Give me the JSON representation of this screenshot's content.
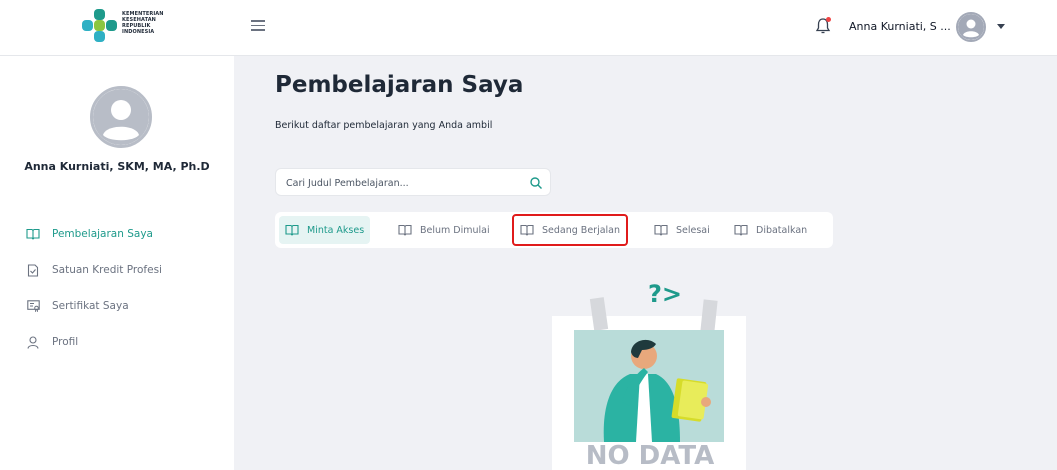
{
  "header": {
    "logo_lines": [
      "KEMENTERIAN",
      "KESEHATAN",
      "REPUBLIK",
      "INDONESIA"
    ],
    "user_name": "Anna Kurniati, S ..."
  },
  "sidebar": {
    "profile_name": "Anna Kurniati, SKM, MA, Ph.D",
    "items": [
      {
        "label": "Pembelajaran Saya",
        "icon": "book-open-icon",
        "active": true
      },
      {
        "label": "Satuan Kredit Profesi",
        "icon": "document-check-icon",
        "active": false
      },
      {
        "label": "Sertifikat Saya",
        "icon": "certificate-icon",
        "active": false
      },
      {
        "label": "Profil",
        "icon": "user-icon",
        "active": false
      }
    ]
  },
  "main": {
    "title": "Pembelajaran Saya",
    "subtitle": "Berikut daftar pembelajaran yang Anda ambil",
    "search": {
      "placeholder": "Cari Judul Pembelajaran...",
      "value": ""
    },
    "tabs": [
      {
        "label": "Minta Akses",
        "active": true
      },
      {
        "label": "Belum Dimulai",
        "active": false
      },
      {
        "label": "Sedang Berjalan",
        "active": false,
        "highlighted": true
      },
      {
        "label": "Selesai",
        "active": false
      },
      {
        "label": "Dibatalkan",
        "active": false
      }
    ],
    "empty_state": {
      "text": "NO DATA",
      "question_marks": "?>"
    }
  },
  "colors": {
    "accent": "#1e9a8b",
    "active_tab_bg": "#e6f4f3",
    "highlight_border": "#e01b1b",
    "page_bg": "#f0f1f5"
  }
}
